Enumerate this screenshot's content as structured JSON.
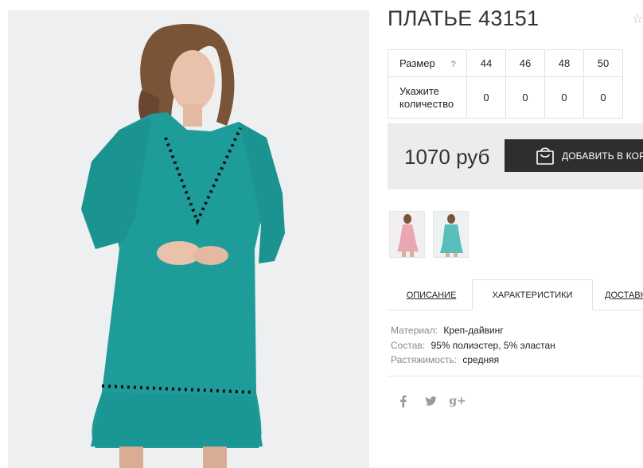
{
  "product": {
    "title": "ПЛАТЬЕ 43151",
    "favorite_icon": "star-outline-icon"
  },
  "size_table": {
    "size_label": "Размер",
    "help_label": "?",
    "sizes": [
      "44",
      "46",
      "48",
      "50"
    ],
    "quantity_label": "Укажите количество",
    "quantities": [
      "0",
      "0",
      "0",
      "0"
    ]
  },
  "purchase": {
    "price": "1070 руб",
    "add_to_cart_label": "ДОБАВИТЬ В КОРЗИНУ",
    "cart_icon": "shopping-bag-icon"
  },
  "gallery": {
    "main_image": "teal-dress-photo",
    "thumbnails": [
      "pink-dress-thumbnail",
      "teal-dress-thumbnail"
    ]
  },
  "tabs": {
    "description": "ОПИСАНИЕ",
    "characteristics": "ХАРАКТЕРИСТИКИ",
    "delivery": "ДОСТАВКА",
    "active": "characteristics"
  },
  "specs": [
    {
      "key": "Материал:",
      "value": "Креп-дайвинг"
    },
    {
      "key": "Состав:",
      "value": "95% полиэстер, 5% эластан"
    },
    {
      "key": "Растяжимость:",
      "value": "средняя"
    }
  ],
  "social": {
    "facebook": "f",
    "twitter": "twitter-bird-icon",
    "googleplus": "g+"
  },
  "colors": {
    "dress_teal": "#1e9c9a",
    "button_dark": "#2e2e2e",
    "price_bg": "#ececec",
    "photo_bg": "#eeeff1"
  }
}
